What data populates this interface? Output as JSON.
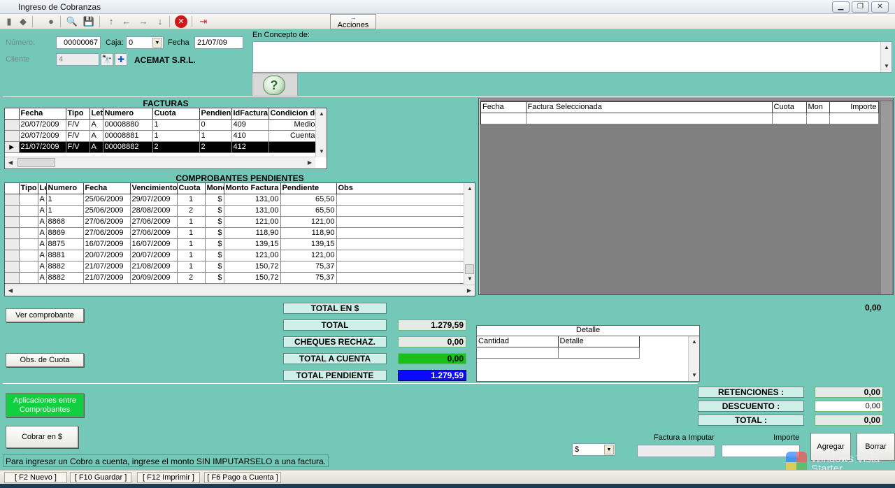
{
  "window": {
    "title": "Ingreso de Cobranzas"
  },
  "toolbar": {
    "acciones_label": "Acciones",
    "icons": [
      "new-icon",
      "edit-icon",
      "delete-icon",
      "search-icon",
      "save-icon",
      "first-icon",
      "prev-icon",
      "next-icon",
      "last-icon",
      "cancel-icon",
      "exit-icon"
    ]
  },
  "form": {
    "numero_label": "Número:",
    "numero_value": "00000067",
    "caja_label": "Caja:",
    "caja_value": "0",
    "fecha_label": "Fecha",
    "fecha_value": "21/07/09",
    "cliente_label": "Cliente",
    "cliente_value": "4",
    "cliente_name": "ACEMAT S.R.L.",
    "concepto_label": "En Concepto de:",
    "concepto_value": ""
  },
  "facturas": {
    "title": "FACTURAS",
    "columns": [
      "Fecha",
      "Tipo",
      "Letra",
      "Numero",
      "Cuota",
      "Pendiente",
      "IdFactura",
      "Condicion de venta"
    ],
    "rows": [
      [
        "20/07/2009",
        "F/V",
        "A",
        "00008880",
        "1",
        "0",
        "409",
        "Medio"
      ],
      [
        "20/07/2009",
        "F/V",
        "A",
        "00008881",
        "1",
        "1",
        "410",
        "Cuenta"
      ],
      [
        "21/07/2009",
        "F/V",
        "A",
        "00008882",
        "2",
        "2",
        "412",
        ""
      ]
    ]
  },
  "comprobantes": {
    "title": "COMPROBANTES PENDIENTES",
    "columns": [
      "Tipo",
      "Letra",
      "Numero",
      "Fecha",
      "Vencimiento",
      "Cuota",
      "Moneda",
      "Monto Factura",
      "Pendiente",
      "Obs"
    ],
    "rows": [
      [
        "",
        "A",
        "1",
        "25/06/2009",
        "29/07/2009",
        "1",
        "$",
        "131,00",
        "65,50",
        ""
      ],
      [
        "",
        "A",
        "1",
        "25/06/2009",
        "28/08/2009",
        "2",
        "$",
        "131,00",
        "65,50",
        ""
      ],
      [
        "",
        "A",
        "8868",
        "27/06/2009",
        "27/06/2009",
        "1",
        "$",
        "121,00",
        "121,00",
        ""
      ],
      [
        "",
        "A",
        "8869",
        "27/06/2009",
        "27/06/2009",
        "1",
        "$",
        "118,90",
        "118,90",
        ""
      ],
      [
        "",
        "A",
        "8875",
        "16/07/2009",
        "16/07/2009",
        "1",
        "$",
        "139,15",
        "139,15",
        ""
      ],
      [
        "",
        "A",
        "8881",
        "20/07/2009",
        "20/07/2009",
        "1",
        "$",
        "121,00",
        "121,00",
        ""
      ],
      [
        "",
        "A",
        "8882",
        "21/07/2009",
        "21/08/2009",
        "1",
        "$",
        "150,72",
        "75,37",
        ""
      ],
      [
        "",
        "A",
        "8882",
        "21/07/2009",
        "20/09/2009",
        "2",
        "$",
        "150,72",
        "75,37",
        ""
      ]
    ]
  },
  "seleccion": {
    "columns": [
      "Fecha",
      "Factura Seleccionada",
      "Cuota",
      "Mon",
      "Importe"
    ]
  },
  "right_total": "0,00",
  "totals": {
    "total_en_label": "TOTAL EN $",
    "total_label": "TOTAL",
    "total_value": "1.279,59",
    "cheques_label": "CHEQUES RECHAZ.",
    "cheques_value": "0,00",
    "cuenta_label": "TOTAL A CUENTA",
    "cuenta_value": "0,00",
    "pendiente_label": "TOTAL PENDIENTE",
    "pendiente_value": "1.279,59"
  },
  "detalle": {
    "title": "Detalle",
    "columns": [
      "Cantidad",
      "Detalle"
    ]
  },
  "buttons": {
    "ver_comprobante": "Ver comprobante",
    "obs_cuota": "Obs. de Cuota",
    "aplicaciones": "Aplicaciones entre Comprobantes",
    "cobrar": "Cobrar en $",
    "agregar": "Agregar",
    "borrar": "Borrar"
  },
  "retenciones": {
    "retenciones_label": "RETENCIONES :",
    "retenciones_value": "0,00",
    "descuento_label": "DESCUENTO :",
    "descuento_value": "0,00",
    "total_label": "TOTAL :",
    "total_value": "0,00"
  },
  "imputar": {
    "moneda_value": "$",
    "factura_label": "Factura a Imputar",
    "importe_label": "Importe"
  },
  "hint": "Para ingresar un Cobro a cuenta, ingrese el monto SIN IMPUTARSELO a una factura.",
  "watermark": {
    "line1": "Windows Vista",
    "line2": "Starter"
  },
  "statusbar": [
    "[ F2 Nuevo ]",
    "[ F10 Guardar ]",
    "[ F12 Imprimir ]",
    "[ F6 Pago a Cuenta ]"
  ],
  "colors": {
    "background": "#74c8b8",
    "cuenta_fill": "#18c018",
    "pendiente_fill": "#0a0aff",
    "aplicaciones_fill": "#10d040"
  }
}
